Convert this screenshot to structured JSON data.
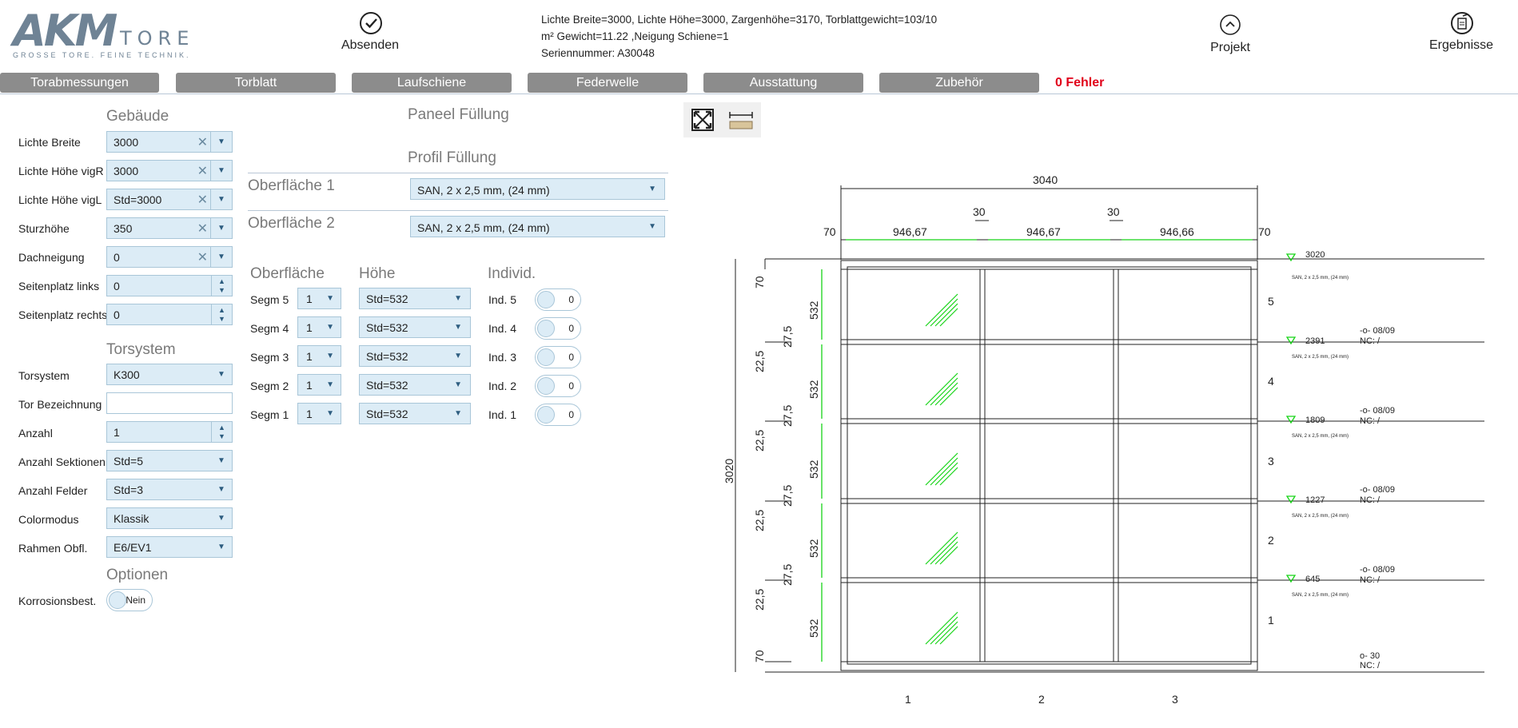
{
  "header": {
    "logo_main": "AKM",
    "logo_tore": "TORE",
    "logo_tagline": "GROSSE TORE. FEINE TECHNIK.",
    "submit_label": "Absenden",
    "project_label": "Projekt",
    "results_label": "Ergebnisse",
    "info_line1": "Lichte Breite=3000,  Lichte Höhe=3000,  Zargenhöhe=3170,  Torblattgewicht=103/10",
    "info_line2": "m² Gewicht=11.22 ,Neigung Schiene=1",
    "info_line3": "Seriennummer: A30048"
  },
  "tabs": [
    {
      "label": "Torabmessungen",
      "active": true
    },
    {
      "label": "Torblatt"
    },
    {
      "label": "Laufschiene"
    },
    {
      "label": "Federwelle"
    },
    {
      "label": "Ausstattung"
    },
    {
      "label": "Zubehör"
    }
  ],
  "errors": "0 Fehler",
  "gebaeude": {
    "title": "Gebäude",
    "lichte_breite": {
      "label": "Lichte Breite",
      "value": "3000"
    },
    "lichte_hoehe_vigr": {
      "label": "Lichte Höhe vigR",
      "value": "3000"
    },
    "lichte_hoehe_vigl": {
      "label": "Lichte Höhe vigL",
      "value": "Std=3000"
    },
    "sturzhoehe": {
      "label": "Sturzhöhe",
      "value": "350"
    },
    "dachneigung": {
      "label": "Dachneigung",
      "value": "0"
    },
    "seitenplatz_links": {
      "label": "Seitenplatz links",
      "value": "0"
    },
    "seitenplatz_rechts": {
      "label": "Seitenplatz rechts",
      "value": "0"
    }
  },
  "torsystem_section": {
    "title": "Torsystem",
    "torsystem": {
      "label": "Torsystem",
      "value": "K300"
    },
    "tor_bezeichnung": {
      "label": "Tor Bezeichnung",
      "value": ""
    },
    "anzahl": {
      "label": "Anzahl",
      "value": "1"
    },
    "anzahl_sektionen": {
      "label": "Anzahl Sektionen",
      "value": "Std=5"
    },
    "anzahl_felder": {
      "label": "Anzahl Felder",
      "value": "Std=3"
    },
    "colormodus": {
      "label": "Colormodus",
      "value": "Klassik"
    },
    "rahmen_obfl": {
      "label": "Rahmen Obfl.",
      "value": "E6/EV1"
    }
  },
  "optionen": {
    "title": "Optionen",
    "korrosion": {
      "label": "Korrosionsbest.",
      "value": "Nein"
    }
  },
  "middle": {
    "paneel_fuellung": "Paneel Füllung",
    "profil_fuellung": "Profil Füllung",
    "oberflaeche1": {
      "label": "Oberfläche 1",
      "value": "SAN, 2 x 2,5 mm, (24 mm)"
    },
    "oberflaeche2": {
      "label": "Oberfläche 2",
      "value": "SAN, 2 x 2,5 mm, (24 mm)"
    },
    "col_oberflaeche": "Oberfläche",
    "col_hoehe": "Höhe",
    "col_individ": "Individ.",
    "segments": [
      {
        "label": "Segm 5",
        "surface": "1",
        "height": "Std=532",
        "ind_label": "Ind. 5",
        "ind_value": "0"
      },
      {
        "label": "Segm 4",
        "surface": "1",
        "height": "Std=532",
        "ind_label": "Ind. 4",
        "ind_value": "0"
      },
      {
        "label": "Segm 3",
        "surface": "1",
        "height": "Std=532",
        "ind_label": "Ind. 3",
        "ind_value": "0"
      },
      {
        "label": "Segm 2",
        "surface": "1",
        "height": "Std=532",
        "ind_label": "Ind. 2",
        "ind_value": "0"
      },
      {
        "label": "Segm 1",
        "surface": "1",
        "height": "Std=532",
        "ind_label": "Ind. 1",
        "ind_value": "0"
      }
    ]
  },
  "drawing": {
    "total_width": "3040",
    "total_height": "3020",
    "edge_left": "70",
    "edge_right": "70",
    "gap1": "30",
    "gap2": "30",
    "field1": "946,67",
    "field2": "946,67",
    "field3": "946,66",
    "segment_height": "532",
    "top_profile": "70",
    "bottom_profile": "70",
    "joint_upper": "27,5",
    "joint_lower": "22,5",
    "segment_numbers": [
      "5",
      "4",
      "3",
      "2",
      "1"
    ],
    "field_numbers": [
      "1",
      "2",
      "3"
    ],
    "level_values": [
      "3020",
      "2391",
      "1809",
      "1227",
      "645"
    ],
    "level_codes": [
      "-o- 08/09",
      "-o- 08/09",
      "-o- 08/09",
      "-o- 08/09"
    ],
    "nc_label": "NC: /",
    "bottom_code": "o- 30",
    "surface_note": "SAN, 2 x 2,5 mm, (24 mm)"
  }
}
